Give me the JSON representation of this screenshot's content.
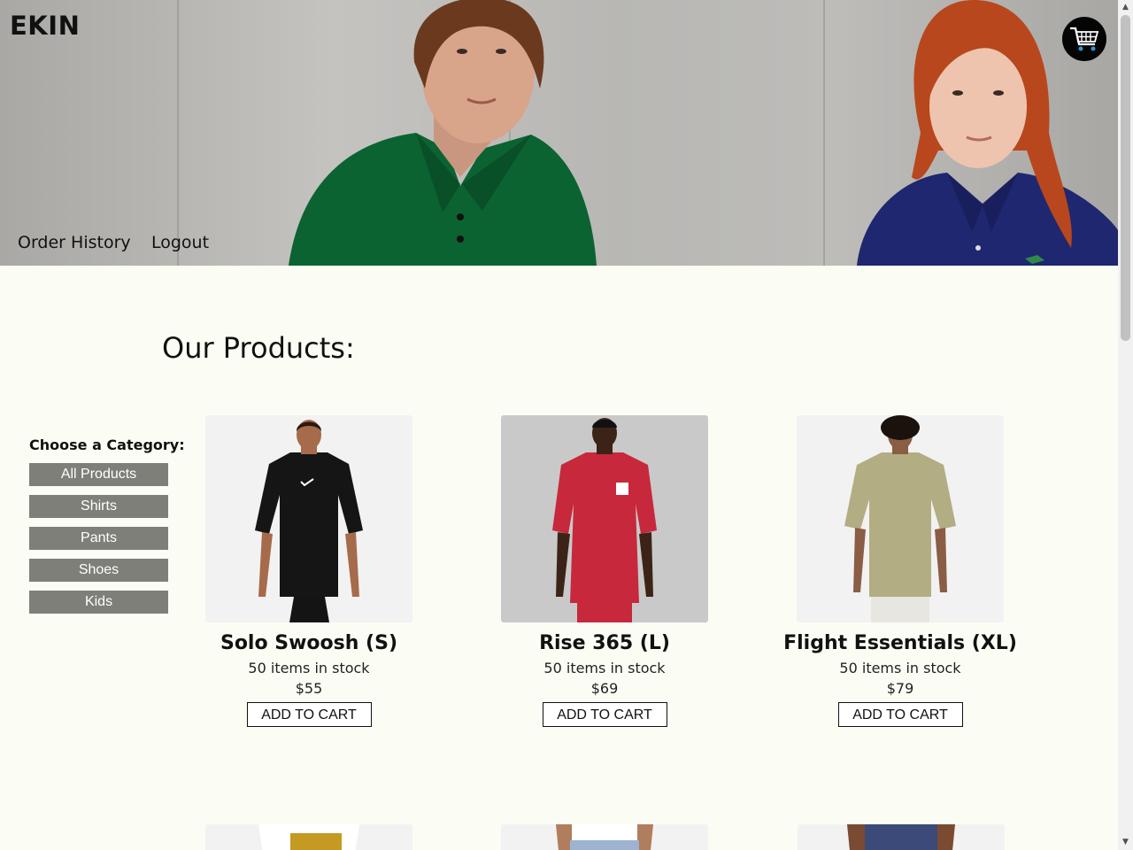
{
  "header": {
    "brand": "EKIN",
    "nav": {
      "order_history": "Order History",
      "logout": "Logout"
    },
    "cart_icon": "shopping-cart-icon"
  },
  "main": {
    "title": "Our Products:"
  },
  "sidebar": {
    "label": "Choose a Category:",
    "categories": [
      "All Products",
      "Shirts",
      "Pants",
      "Shoes",
      "Kids"
    ]
  },
  "products": [
    {
      "name": "Solo Swoosh (S)",
      "stock": "50 items in stock",
      "price": "$55",
      "button": "ADD TO CART",
      "shirt_color": "#151515"
    },
    {
      "name": "Rise 365 (L)",
      "stock": "50 items in stock",
      "price": "$69",
      "button": "ADD TO CART",
      "shirt_color": "#c7283b"
    },
    {
      "name": "Flight Essentials (XL)",
      "stock": "50 items in stock",
      "price": "$79",
      "button": "ADD TO CART",
      "shirt_color": "#b3ad83"
    }
  ],
  "colors": {
    "page_background": "#fbfdf4",
    "category_button": "#7d7f78",
    "green_polo": "#0b6332",
    "navy_polo": "#1f2770"
  }
}
